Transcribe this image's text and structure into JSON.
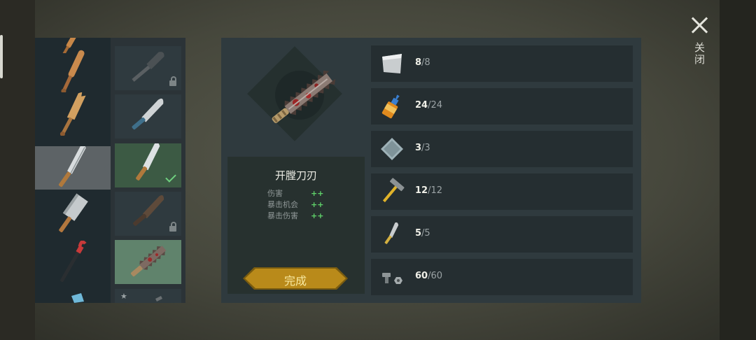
{
  "close_label": "关闭",
  "categories": [
    {
      "icon": "bat-icon"
    },
    {
      "icon": "bat-icon"
    },
    {
      "icon": "broken-bat-icon"
    },
    {
      "icon": "machete-icon",
      "selected": true
    },
    {
      "icon": "cleaver-icon"
    },
    {
      "icon": "crowbar-icon"
    },
    {
      "icon": "axe-icon"
    }
  ],
  "options": [
    {
      "icon": "sickle-icon",
      "locked": true
    },
    {
      "icon": "machete-icon"
    },
    {
      "icon": "machete-icon",
      "equipped": true
    },
    {
      "icon": "rusty-machete-icon",
      "locked": true
    },
    {
      "icon": "serrated-machete-icon",
      "chosen": true
    },
    {
      "icon": "machete-icon",
      "starred": true
    }
  ],
  "weapon": {
    "name": "开膛刀刃",
    "icon": "serrated-machete-icon",
    "stats": [
      {
        "label": "伤害",
        "value": "++"
      },
      {
        "label": "暴击机会",
        "value": "++"
      },
      {
        "label": "暴击伤害",
        "value": "++"
      }
    ]
  },
  "done_label": "完成",
  "materials": [
    {
      "icon": "metal-plate-icon",
      "have": "8",
      "need": "/8"
    },
    {
      "icon": "glue-icon",
      "have": "24",
      "need": "/24"
    },
    {
      "icon": "steel-plate-icon",
      "have": "3",
      "need": "/3"
    },
    {
      "icon": "hammer-icon",
      "have": "12",
      "need": "/12"
    },
    {
      "icon": "blade-icon",
      "have": "5",
      "need": "/5"
    },
    {
      "icon": "nuts-bolts-icon",
      "have": "60",
      "need": "/60"
    }
  ],
  "colors": {
    "accent": "#b98a1a",
    "positive": "#5fd36a",
    "equipped": "#3c5a44",
    "chosen": "#60836c"
  }
}
